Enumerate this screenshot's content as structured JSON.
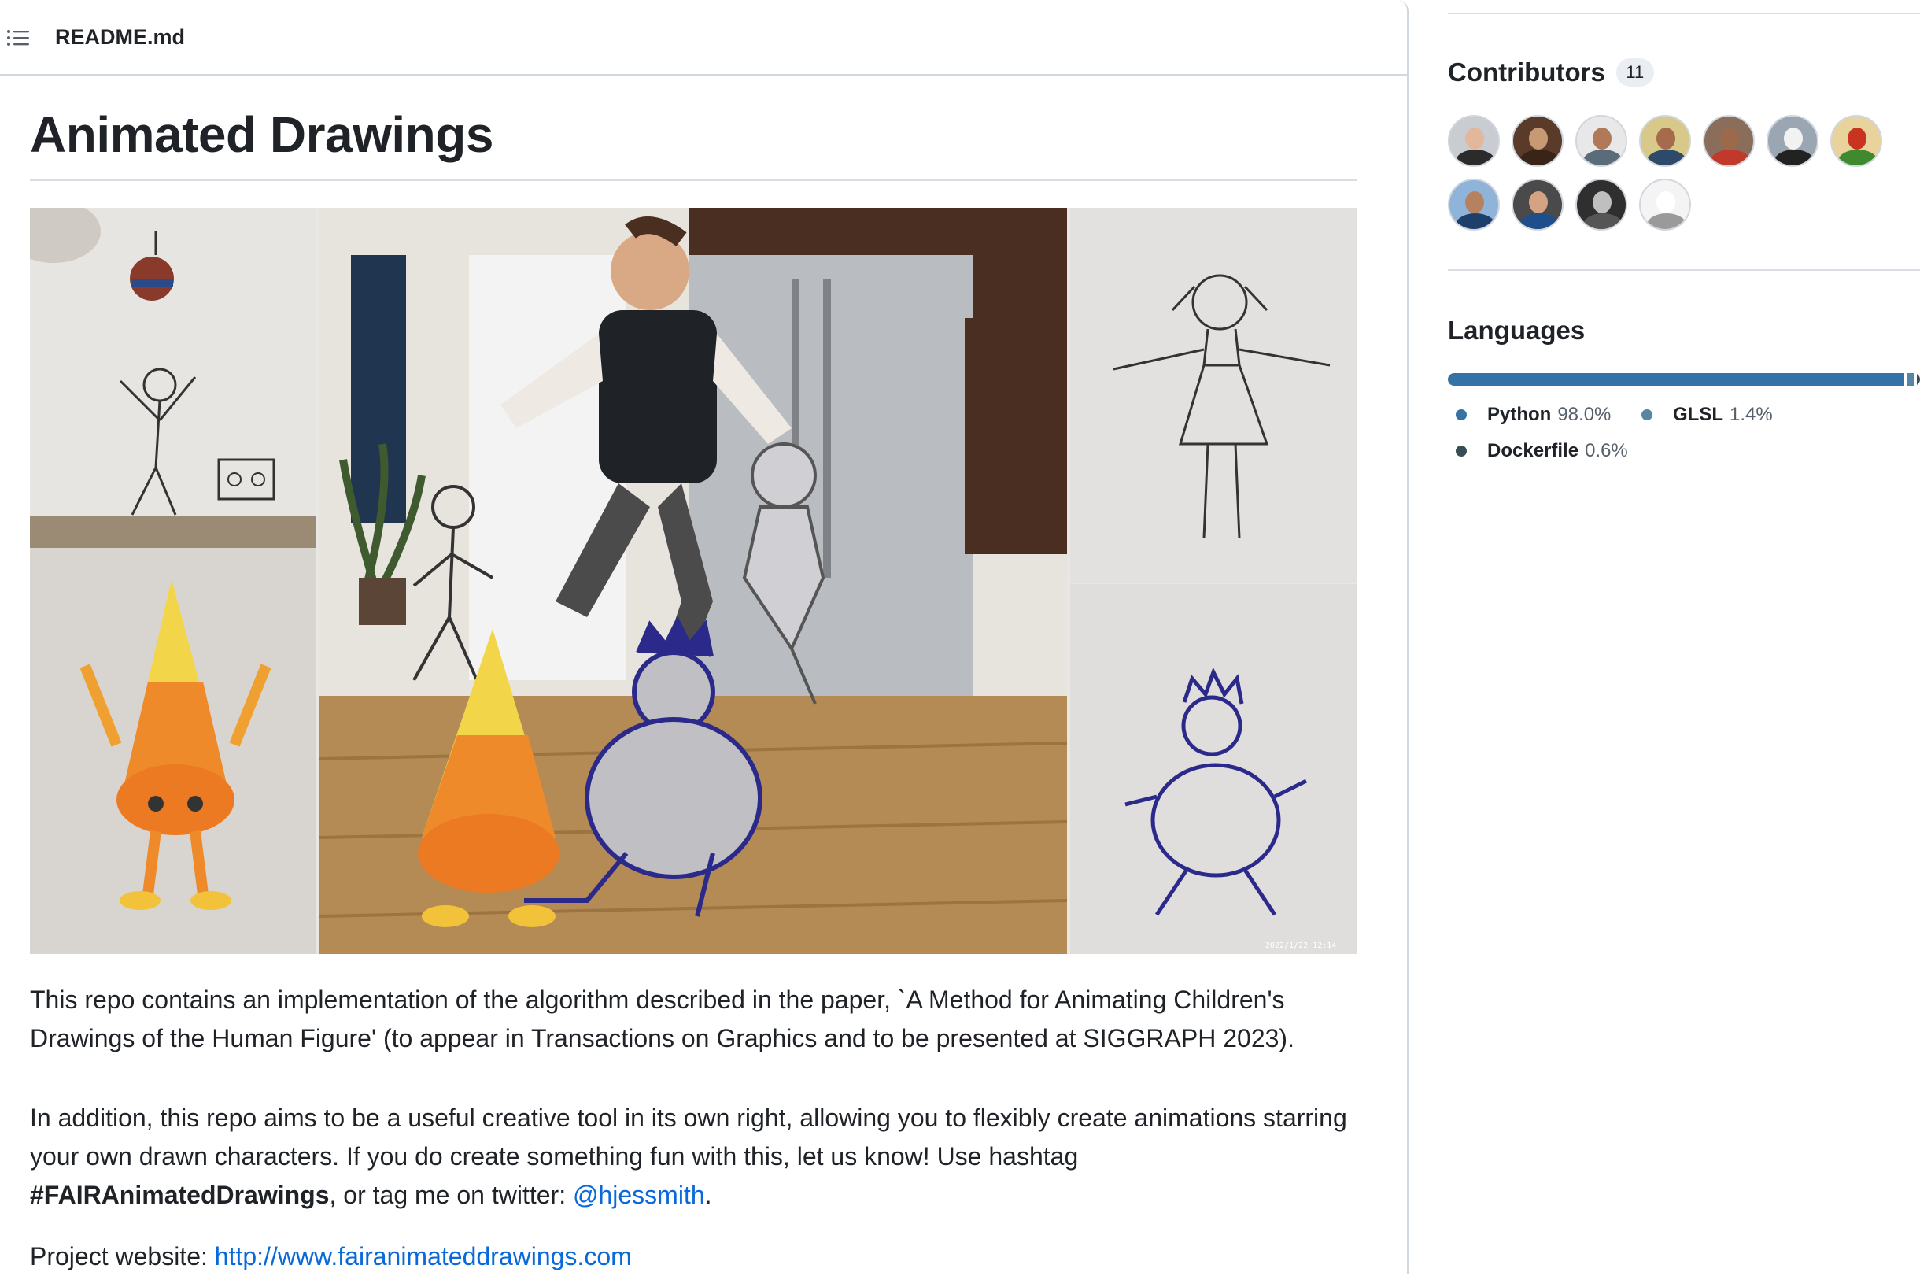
{
  "readme": {
    "filename": "README.md",
    "title": "Animated Drawings",
    "paragraph_1": "This repo contains an implementation of the algorithm described in the paper, `A Method for Animating Children's Drawings of the Human Figure' (to appear in Transactions on Graphics and to be presented at SIGGRAPH 2023).",
    "paragraph_2_text": "In addition, this repo aims to be a useful creative tool in its own right, allowing you to flexibly create animations starring your own drawn characters. If you do create something fun with this, let us know! Use hashtag",
    "paragraph_2_hashtag": "#FAIRAnimatedDrawings",
    "paragraph_2_mid": ", or tag me on twitter:",
    "paragraph_2_handle": "@hjessmith",
    "paragraph_2_end": ".",
    "project_label": "Project website:",
    "project_url": "http://www.fairanimateddrawings.com",
    "image_timestamp": "2022/1/22 12:14"
  },
  "sidebar": {
    "contributors": {
      "heading": "Contributors",
      "count": "11",
      "avatars": [
        {
          "bg": "#c9ccd1",
          "face": "#e2b89c",
          "body": "#2b2b2b"
        },
        {
          "bg": "#5a3b2a",
          "face": "#c89a74",
          "body": "#3a2418"
        },
        {
          "bg": "#e8e8e8",
          "face": "#b07a58",
          "body": "#5a6b7a"
        },
        {
          "bg": "#d8c98a",
          "face": "#a56b4a",
          "body": "#2d4a6b"
        },
        {
          "bg": "#8a6d5a",
          "face": "#9c6a4a",
          "body": "#c0392b"
        },
        {
          "bg": "#9aa6b2",
          "face": "#f2f2f2",
          "body": "#222222"
        },
        {
          "bg": "#e9d39c",
          "face": "#c8341f",
          "body": "#3f8a2e"
        },
        {
          "bg": "#8fb3d9",
          "face": "#b5815e",
          "body": "#1f3f6b"
        },
        {
          "bg": "#4a4a4a",
          "face": "#d4a384",
          "body": "#1f4f8a"
        },
        {
          "bg": "#2f2f2f",
          "face": "#bfbfbf",
          "body": "#555555"
        },
        {
          "bg": "#f4f4f4",
          "face": "#ffffff",
          "body": "#9a9a9a"
        }
      ]
    },
    "languages": {
      "heading": "Languages",
      "items": [
        {
          "name": "Python",
          "percent": "98.0%",
          "value": 98.0,
          "color": "#3572A5"
        },
        {
          "name": "GLSL",
          "percent": "1.4%",
          "value": 1.4,
          "color": "#5686a5"
        },
        {
          "name": "Dockerfile",
          "percent": "0.6%",
          "value": 0.6,
          "color": "#384d54"
        }
      ]
    }
  }
}
